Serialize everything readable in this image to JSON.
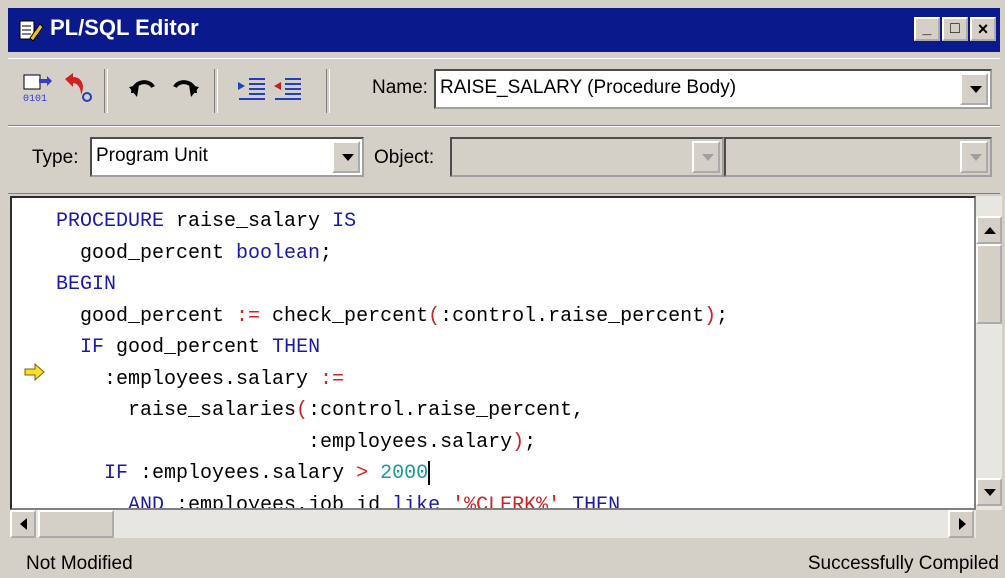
{
  "window": {
    "title": "PL/SQL Editor",
    "controls": {
      "minimize": "_",
      "maximize": "□",
      "close": "×"
    }
  },
  "toolbar": {
    "name_label": "Name:",
    "name_value": "RAISE_SALARY (Procedure Body)",
    "type_label": "Type:",
    "type_value": "Program Unit",
    "object_label": "Object:",
    "object_value": "",
    "object2_value": ""
  },
  "editor": {
    "lines": [
      [
        {
          "t": "PROCEDURE",
          "c": "kw"
        },
        {
          "t": " raise_salary "
        },
        {
          "t": "IS",
          "c": "kw"
        }
      ],
      [
        {
          "t": "  good_percent "
        },
        {
          "t": "boolean",
          "c": "kw"
        },
        {
          "t": ";"
        }
      ],
      [
        {
          "t": "BEGIN",
          "c": "kw"
        }
      ],
      [
        {
          "t": "  good_percent "
        },
        {
          "t": ":=",
          "c": "op"
        },
        {
          "t": " check_percent"
        },
        {
          "t": "(",
          "c": "op"
        },
        {
          "t": ":control.raise_percent"
        },
        {
          "t": ")",
          "c": "op"
        },
        {
          "t": ";"
        }
      ],
      [
        {
          "t": "  "
        },
        {
          "t": "IF",
          "c": "kw"
        },
        {
          "t": " good_percent "
        },
        {
          "t": "THEN",
          "c": "kw"
        }
      ],
      [
        {
          "t": "    :employees.salary "
        },
        {
          "t": ":=",
          "c": "op"
        }
      ],
      [
        {
          "t": "      raise_salaries"
        },
        {
          "t": "(",
          "c": "op"
        },
        {
          "t": ":control.raise_percent,"
        }
      ],
      [
        {
          "t": "                     :employees.salary"
        },
        {
          "t": ")",
          "c": "op"
        },
        {
          "t": ";"
        }
      ],
      [
        {
          "t": "    "
        },
        {
          "t": "IF",
          "c": "kw"
        },
        {
          "t": " :employees.salary "
        },
        {
          "t": ">",
          "c": "op"
        },
        {
          "t": " "
        },
        {
          "t": "2000",
          "c": "num"
        },
        {
          "t": "",
          "cursor": true
        }
      ],
      [
        {
          "t": "      "
        },
        {
          "t": "AND",
          "c": "kw"
        },
        {
          "t": " :employees.job_id "
        },
        {
          "t": "like",
          "c": "kw"
        },
        {
          "t": " "
        },
        {
          "t": "'%CLERK%'",
          "c": "str"
        },
        {
          "t": " "
        },
        {
          "t": "THEN",
          "c": "kw"
        }
      ]
    ],
    "execution_line": 6
  },
  "status": {
    "left": "Not Modified",
    "right": "Successfully Compiled"
  },
  "colors": {
    "title_bar": "#0a1a8c",
    "keyword": "#1a1aa6",
    "operator": "#cc2222",
    "number": "#1a9a9a"
  },
  "icons": [
    "compile-icon",
    "navigate-back-icon",
    "undo-icon",
    "redo-icon",
    "indent-icon",
    "outdent-icon",
    "execution-arrow-icon"
  ]
}
